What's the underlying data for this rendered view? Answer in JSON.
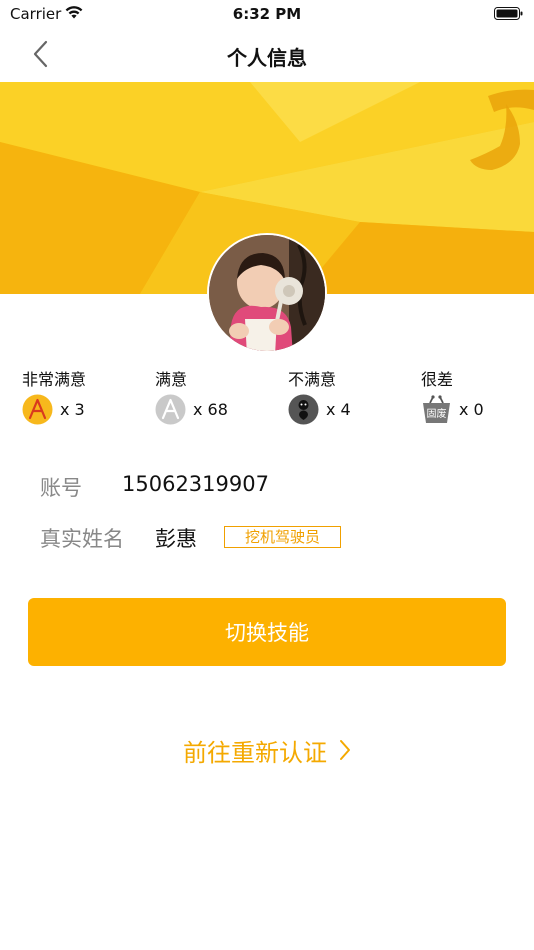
{
  "status_bar": {
    "carrier": "Carrier",
    "time": "6:32 PM"
  },
  "nav": {
    "title": "个人信息",
    "back_icon": "chevron-left-icon"
  },
  "ratings": [
    {
      "label": "非常满意",
      "count": "x 3",
      "icon": "very-satisfied-icon"
    },
    {
      "label": "满意",
      "count": "x 68",
      "icon": "satisfied-icon"
    },
    {
      "label": "不满意",
      "count": "x 4",
      "icon": "unsatisfied-icon"
    },
    {
      "label": "很差",
      "count": "x 0",
      "icon": "very-bad-icon"
    }
  ],
  "very_bad_icon_text": "固废",
  "account": {
    "label": "账号",
    "value": "15062319907"
  },
  "real_name": {
    "label": "真实姓名",
    "value": "彭惠",
    "skill_badge": "挖机驾驶员"
  },
  "switch_button": {
    "label": "切换技能"
  },
  "reauth_link": {
    "label": "前往重新认证"
  },
  "colors": {
    "accent": "#fdb100",
    "link": "#f4a900",
    "banner": "#f9c315"
  }
}
